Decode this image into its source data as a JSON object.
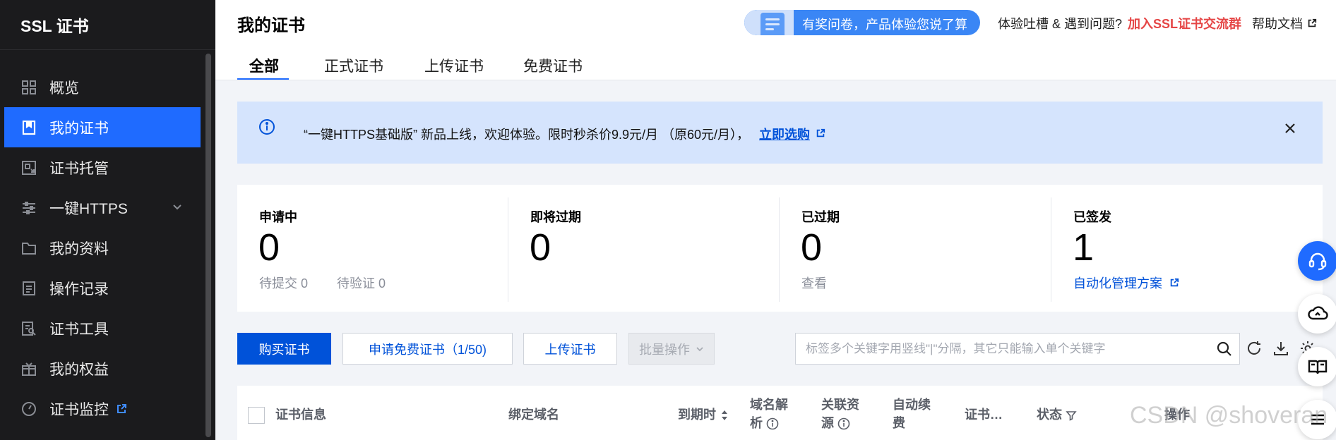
{
  "sidebar": {
    "title": "SSL 证书",
    "items": [
      {
        "label": "概览",
        "icon": "dashboard-icon"
      },
      {
        "label": "我的证书",
        "icon": "certificate-icon"
      },
      {
        "label": "证书托管",
        "icon": "hosting-icon"
      },
      {
        "label": "一键HTTPS",
        "icon": "sliders-icon"
      },
      {
        "label": "我的资料",
        "icon": "folder-icon"
      },
      {
        "label": "操作记录",
        "icon": "log-icon"
      },
      {
        "label": "证书工具",
        "icon": "tool-icon"
      },
      {
        "label": "我的权益",
        "icon": "gift-icon"
      },
      {
        "label": "证书监控",
        "icon": "monitor-icon"
      }
    ],
    "active_index": 1
  },
  "header": {
    "title": "我的证书",
    "survey_label": "有奖问卷，产品体验您说了算",
    "feedback_text": "体验吐槽 & 遇到问题?",
    "join_group": "加入SSL证书交流群",
    "help_docs": "帮助文档",
    "tabs": [
      "全部",
      "正式证书",
      "上传证书",
      "免费证书"
    ],
    "active_tab": 0
  },
  "notice": {
    "text": "“一键HTTPS基础版” 新品上线，欢迎体验。限时秒杀价9.9元/月 （原60元/月），",
    "link": "立即选购"
  },
  "stats": [
    {
      "label": "申请中",
      "value": "0",
      "sub1": "待提交 0",
      "sub2": "待验证 0"
    },
    {
      "label": "即将过期",
      "value": "0"
    },
    {
      "label": "已过期",
      "value": "0",
      "sub1": "查看"
    },
    {
      "label": "已签发",
      "value": "1",
      "link": "自动化管理方案"
    }
  ],
  "toolbar": {
    "buy": "购买证书",
    "apply_free": "申请免费证书（1/50)",
    "upload": "上传证书",
    "batch": "批量操作",
    "search_placeholder": "标签多个关键字用竖线\"|\"分隔，其它只能输入单个关键字"
  },
  "table": {
    "columns": [
      "证书信息",
      "绑定域名",
      "到期时",
      "域名解",
      "析",
      "关联资",
      "源",
      "自动续",
      "费",
      "证书…",
      "状态",
      "操作"
    ]
  },
  "watermark": "CSDN @shoveran",
  "colors": {
    "sidebar_bg": "#1b1b1d",
    "active_nav": "#1f6bff",
    "primary": "#0052d9",
    "notice_bg": "#d5e4fd",
    "danger": "#e54545"
  }
}
